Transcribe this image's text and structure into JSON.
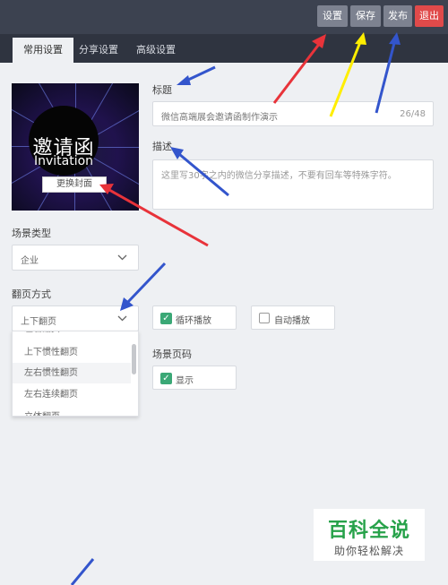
{
  "topbar": {
    "settings": "设置",
    "save": "保存",
    "publish": "发布",
    "exit": "退出"
  },
  "tabs": [
    "常用设置",
    "分享设置",
    "高级设置"
  ],
  "cover": {
    "title_cn": "邀请函",
    "title_en": "Invitation",
    "change_button": "更换封面"
  },
  "title_field": {
    "label": "标题",
    "value": "微信高端展会邀请函制作演示",
    "count": "26/48"
  },
  "desc_field": {
    "label": "描述",
    "placeholder": "这里写30字之内的微信分享描述，不要有回车等特殊字符。"
  },
  "scene_type": {
    "label": "场景类型",
    "value": "企业"
  },
  "page_turn": {
    "label": "翻页方式",
    "value": "上下翻页",
    "options": [
      "左右翻页",
      "上下惯性翻页",
      "左右惯性翻页",
      "左右连续翻页",
      "立体翻页"
    ]
  },
  "loop_play": {
    "label": "循环播放",
    "checked": true
  },
  "auto_play": {
    "label": "自动播放",
    "checked": false
  },
  "page_number": {
    "label": "场景页码",
    "show_label": "显示",
    "checked": true
  },
  "watermark": {
    "main": "百科全说",
    "sub": "助你轻松解决"
  },
  "colors": {
    "topbar": "#3c4250",
    "tabbar": "#2f3440",
    "exit": "#e04a4a",
    "check": "#3aa876",
    "watermark": "#27a24a",
    "arrow_red": "#e8333a",
    "arrow_yellow": "#ffee00",
    "arrow_blue": "#3355cc"
  }
}
